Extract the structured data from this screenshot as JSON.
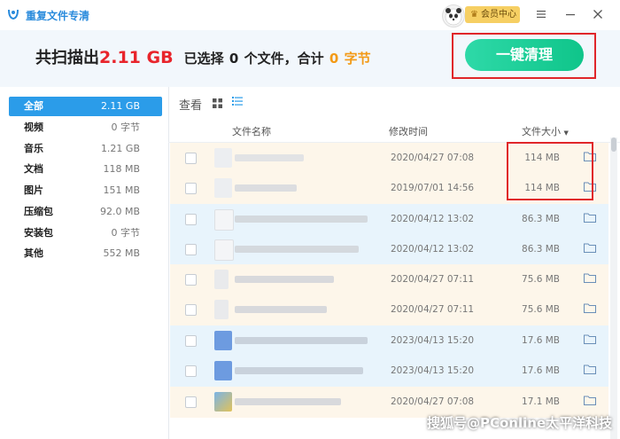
{
  "app": {
    "title": "重复文件专清"
  },
  "titlebar": {
    "vip_label": "会员中心",
    "menu_icon": "menu-icon",
    "minimize_icon": "minimize-icon",
    "close_icon": "close-icon"
  },
  "summary": {
    "prefix": "共扫描出",
    "total": "2.11 GB",
    "selected_prefix": "已选择",
    "selected_count": "0",
    "selected_suffix": "个文件，合计",
    "selected_size": "0",
    "selected_unit": "字节"
  },
  "clean_button": "一键清理",
  "sidebar": {
    "items": [
      {
        "name": "全部",
        "size": "2.11 GB",
        "active": true
      },
      {
        "name": "视频",
        "size": "0 字节"
      },
      {
        "name": "音乐",
        "size": "1.21 GB"
      },
      {
        "name": "文档",
        "size": "118 MB"
      },
      {
        "name": "图片",
        "size": "151 MB"
      },
      {
        "name": "压缩包",
        "size": "92.0 MB"
      },
      {
        "name": "安装包",
        "size": "0 字节"
      },
      {
        "name": "其他",
        "size": "552 MB"
      }
    ]
  },
  "view": {
    "label": "查看",
    "mode": "list"
  },
  "columns": {
    "name": "文件名称",
    "modified": "修改时间",
    "size": "文件大小",
    "sort_indicator": "▼"
  },
  "rows": [
    {
      "date": "2020/04/27 07:08",
      "size": "114 MB"
    },
    {
      "date": "2019/07/01 14:56",
      "size": "114 MB"
    },
    {
      "date": "2020/04/12 13:02",
      "size": "86.3 MB"
    },
    {
      "date": "2020/04/12 13:02",
      "size": "86.3 MB"
    },
    {
      "date": "2020/04/27 07:11",
      "size": "75.6 MB"
    },
    {
      "date": "2020/04/27 07:11",
      "size": "75.6 MB"
    },
    {
      "date": "2023/04/13 15:20",
      "size": "17.6 MB"
    },
    {
      "date": "2023/04/13 15:20",
      "size": "17.6 MB"
    },
    {
      "date": "2020/04/27 07:08",
      "size": "17.1 MB"
    }
  ],
  "colors": {
    "group_a": "#fdf6ea",
    "group_b": "#e8f4fc",
    "accent": "#2b9ce9",
    "highlight": "#e0262a"
  },
  "watermark": "搜狐号@PConline太平洋科技"
}
